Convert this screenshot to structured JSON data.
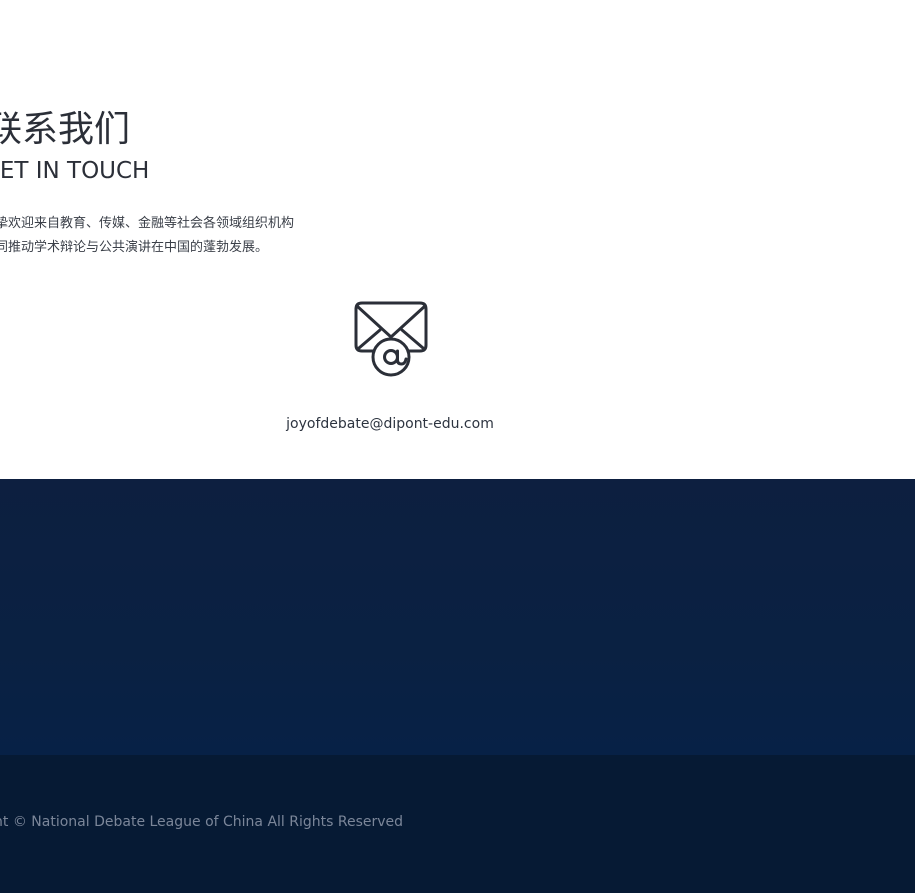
{
  "contact": {
    "heading_cn": "联系我们",
    "heading_en": "GET IN TOUCH",
    "desc_line1": "诚挚欢迎来自教育、传媒、金融等社会各领域组织机构",
    "desc_line2": "共同推动学术辩论与公共演讲在中国的蓬勃发展。",
    "mail_icon": "envelope-at-icon",
    "email": "joyofdebate@dipont-edu.com"
  },
  "footer": {
    "copyright": "Copyright © National Debate League of China All Rights Reserved"
  },
  "colors": {
    "band": "#0a2142",
    "footer": "#061a34",
    "heading": "#2b2f38",
    "copyright": "#7b8699"
  }
}
